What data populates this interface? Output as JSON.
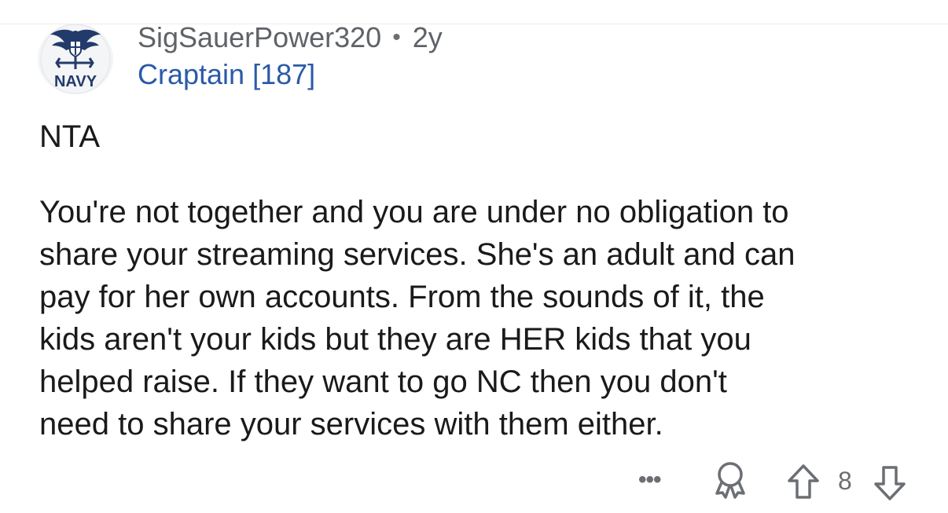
{
  "comment": {
    "username": "SigSauerPower320",
    "separator": "•",
    "age": "2y",
    "flair": "Craptain [187]",
    "avatar_text": "NAVY",
    "avatar_icon": "navy-emblem-icon",
    "paragraphs": [
      "NTA",
      "You're not together and you are under no obligation to\nshare your streaming services. She's an adult and can\npay for her own accounts. From the sounds of it, the\nkids aren't your kids but they are HER kids that you\nhelped raise. If they want to go NC then you don't\nneed to share your services with them either."
    ]
  },
  "actions": {
    "more_label": "•••",
    "award_icon": "award-ribbon-icon",
    "upvote_icon": "upvote-arrow-icon",
    "score": "8",
    "downvote_icon": "downvote-arrow-icon"
  },
  "colors": {
    "username": "#5f6368",
    "flair": "#2b5aa8",
    "body": "#1a1a1b",
    "icon": "#6b6f73"
  }
}
